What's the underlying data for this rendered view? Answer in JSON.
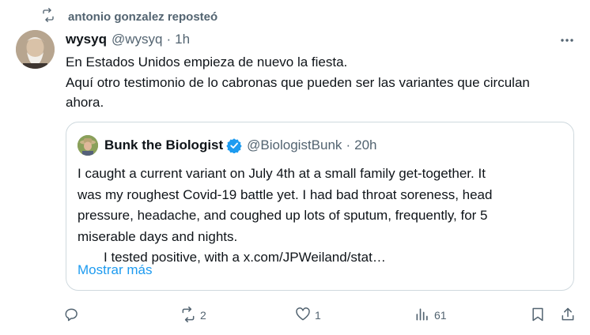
{
  "repost": {
    "text": "antonio gonzalez reposteó",
    "icon": "repost-icon"
  },
  "tweet": {
    "name": "wysyq",
    "handle": "@wysyq",
    "separator": "·",
    "time": "1h",
    "lines": [
      "En Estados Unidos empieza de nuevo la fiesta.",
      "Aquí otro testimonio de lo cabronas que pueden ser las variantes que circulan",
      "ahora."
    ]
  },
  "quote": {
    "name": "Bunk the Biologist",
    "verified": true,
    "handle": "@BiologistBunk",
    "separator": "·",
    "time": "20h",
    "lines": [
      "I caught a current variant on July 4th at a small family get-together.   It",
      "was my roughest Covid-19 battle yet.  I had bad throat soreness, head",
      "pressure, headache, and coughed up lots of sputum,  frequently,  for 5",
      "miserable days and nights.",
      "I tested positive, with a x.com/JPWeiland/stat…"
    ],
    "show_more": "Mostrar más"
  },
  "actions": {
    "reply": {
      "icon": "reply-icon",
      "count": ""
    },
    "repost": {
      "icon": "repost-icon",
      "count": "2"
    },
    "like": {
      "icon": "heart-icon",
      "count": "1"
    },
    "views": {
      "icon": "analytics-icon",
      "count": "61"
    },
    "bookmark": {
      "icon": "bookmark-icon"
    },
    "share": {
      "icon": "share-icon"
    }
  },
  "colors": {
    "text": "#0f1419",
    "secondary": "#536471",
    "accent": "#1d9bf0",
    "border": "#cfd9de"
  }
}
